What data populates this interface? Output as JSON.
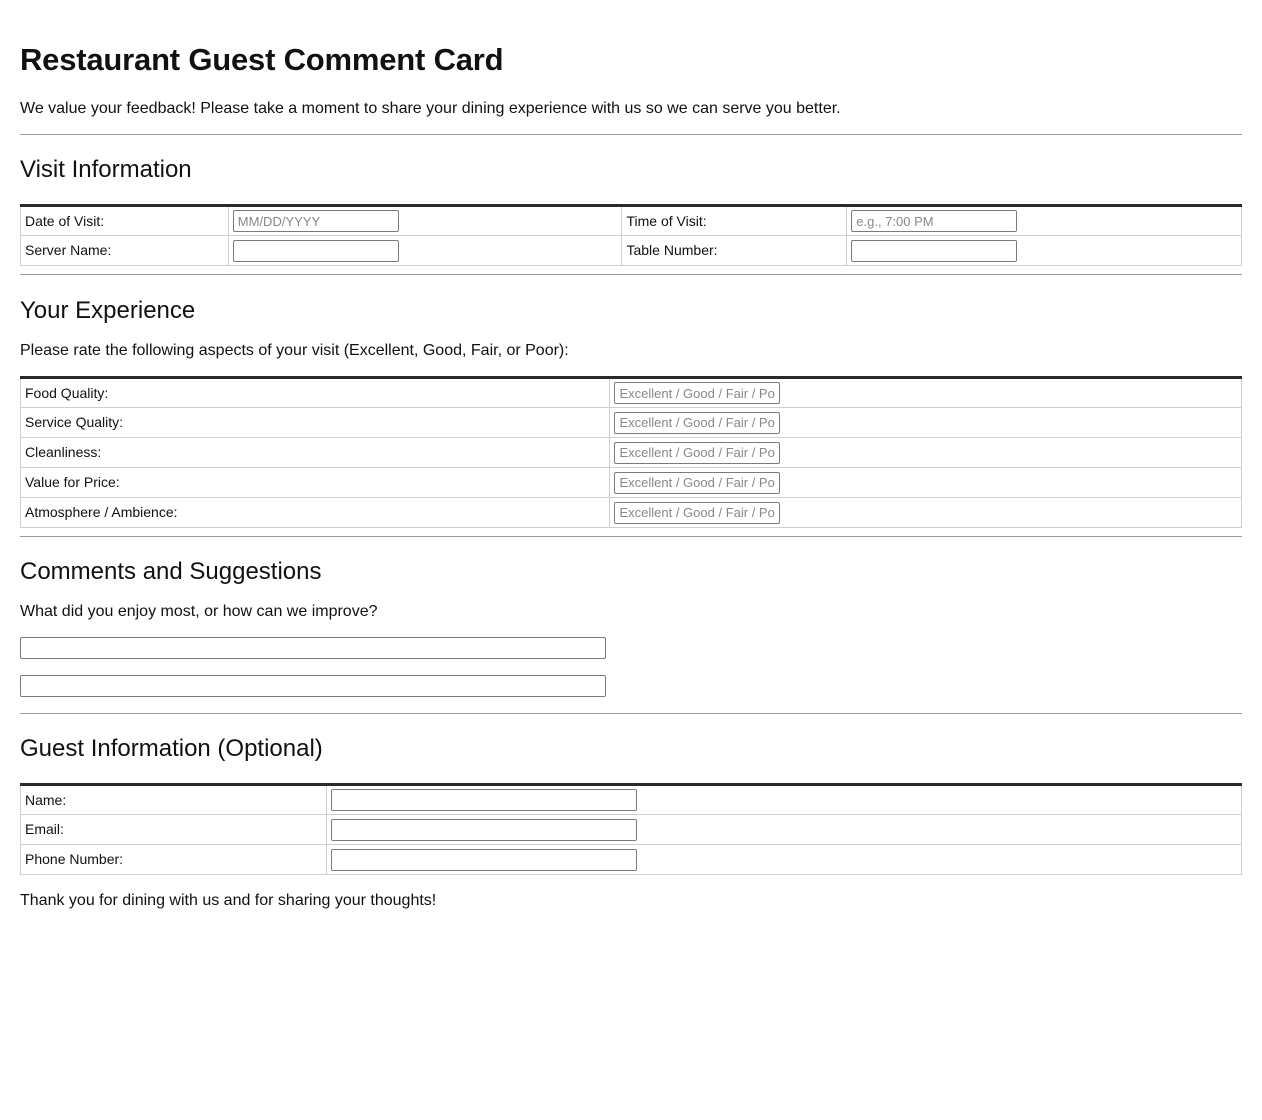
{
  "title": "Restaurant Guest Comment Card",
  "intro": "We value your feedback! Please take a moment to share your dining experience with us so we can serve you better.",
  "visit": {
    "heading": "Visit Information",
    "date_label": "Date of Visit:",
    "date_placeholder": "MM/DD/YYYY",
    "time_label": "Time of Visit:",
    "time_placeholder": "e.g., 7:00 PM",
    "server_label": "Server Name:",
    "table_label": "Table Number:"
  },
  "experience": {
    "heading": "Your Experience",
    "instructions": "Please rate the following aspects of your visit (Excellent, Good, Fair, or Poor):",
    "rating_placeholder": "Excellent / Good / Fair / Poor",
    "rows": [
      {
        "label": "Food Quality:"
      },
      {
        "label": "Service Quality:"
      },
      {
        "label": "Cleanliness:"
      },
      {
        "label": "Value for Price:"
      },
      {
        "label": "Atmosphere / Ambience:"
      }
    ]
  },
  "comments": {
    "heading": "Comments and Suggestions",
    "prompt": "What did you enjoy most, or how can we improve?",
    "line1": "",
    "line2": ""
  },
  "guest": {
    "heading": "Guest Information (Optional)",
    "name_label": "Name:",
    "email_label": "Email:",
    "phone_label": "Phone Number:"
  },
  "closing": "Thank you for dining with us and for sharing your thoughts!"
}
